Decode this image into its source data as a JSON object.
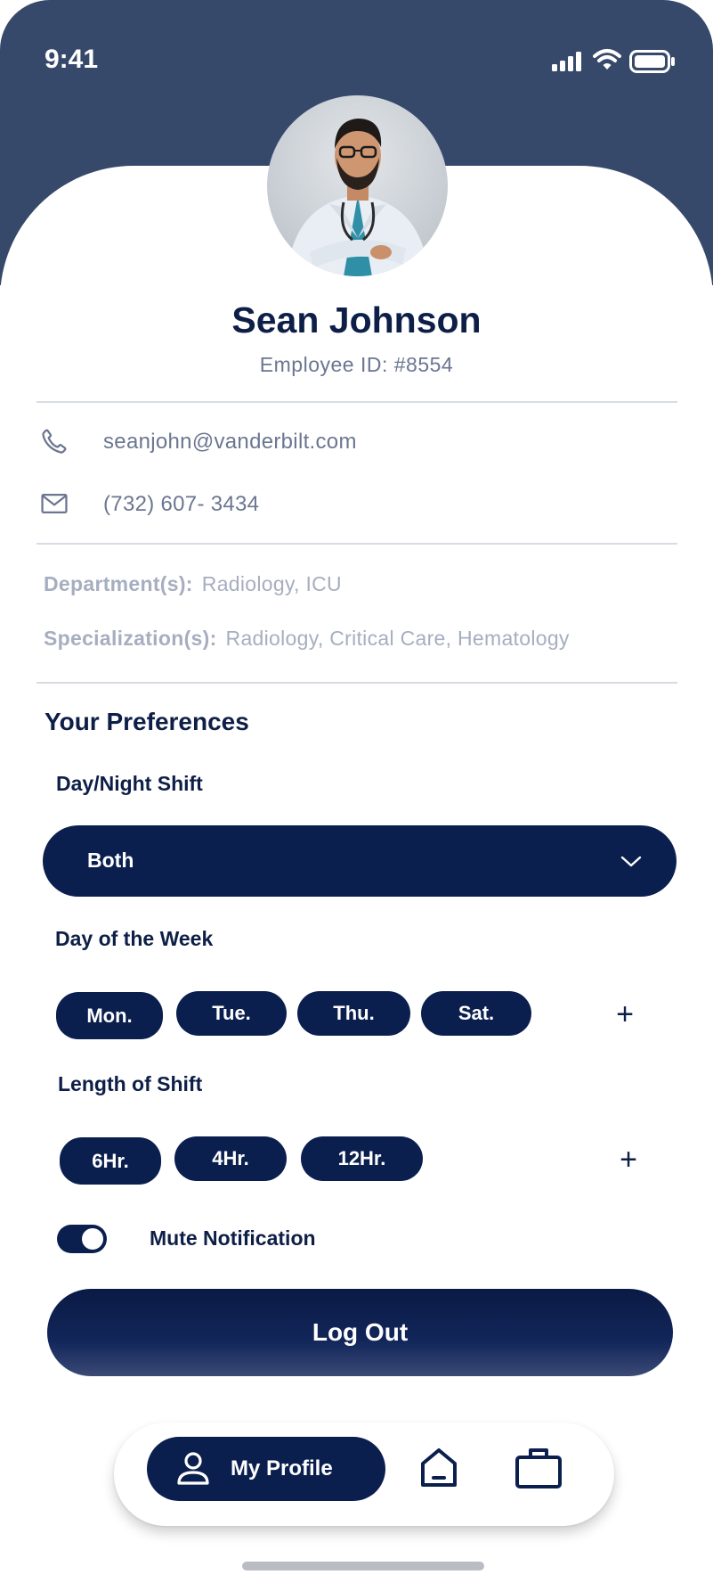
{
  "status_bar": {
    "time": "9:41",
    "icons": [
      "signal-icon",
      "wifi-icon",
      "battery-icon"
    ]
  },
  "profile": {
    "name": "Sean Johnson",
    "employee_id": "Employee ID: #8554",
    "avatar": "doctor-photo"
  },
  "contact": {
    "email": "seanjohn@vanderbilt.com",
    "email_icon": "phone-icon",
    "phone": "(732) 607- 3434",
    "phone_icon": "mail-icon"
  },
  "info": {
    "department_label": "Department(s):",
    "department_value": "Radiology, ICU",
    "specialization_label": "Specialization(s):",
    "specialization_value": "Radiology, Critical Care, Hematology"
  },
  "preferences": {
    "title": "Your Preferences",
    "shift_label": "Day/Night Shift",
    "shift_value": "Both",
    "week_label": "Day of the Week",
    "days": [
      "Mon.",
      "Tue.",
      "Thu.",
      "Sat."
    ],
    "length_label": "Length of Shift",
    "lengths": [
      "6Hr.",
      "4Hr.",
      "12Hr."
    ],
    "add_symbol": "+",
    "mute_label": "Mute Notification",
    "mute_on": true
  },
  "actions": {
    "logout": "Log Out"
  },
  "bottom_nav": {
    "active_label": "My Profile",
    "items": [
      "user-icon",
      "home-icon",
      "briefcase-icon"
    ]
  },
  "colors": {
    "header": "#37496b",
    "primary": "#0b1f4f",
    "text_dark": "#0e1f47",
    "text_muted": "#6b7690",
    "text_light": "#a6aebf"
  }
}
